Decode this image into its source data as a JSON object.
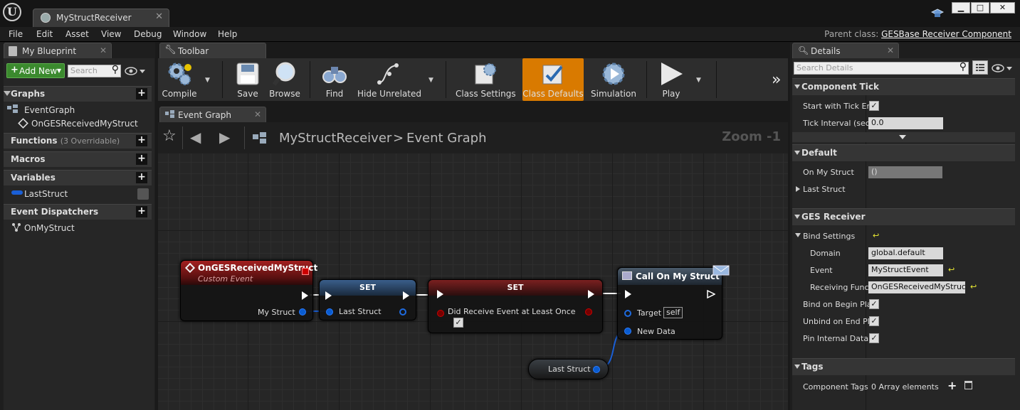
{
  "window": {
    "tab_title": "MyStructReceiver",
    "close": "✕",
    "min": "▁",
    "max": "□",
    "close_btn": "✕"
  },
  "menu": [
    "File",
    "Edit",
    "Asset",
    "View",
    "Debug",
    "Window",
    "Help"
  ],
  "parent_class": {
    "label": "Parent class:",
    "value": "GESBase Receiver Component"
  },
  "my_blueprint": {
    "tab": "My Blueprint",
    "add_new": "Add New",
    "search_placeholder": "Search",
    "graphs": "Graphs",
    "event_graph": "EventGraph",
    "custom_event": "OnGESReceivedMyStruct",
    "functions": "Functions",
    "functions_note": "(3 Overridable)",
    "macros": "Macros",
    "variables": "Variables",
    "var_last": "LastStruct",
    "dispatchers": "Event Dispatchers",
    "dispatcher": "OnMyStruct"
  },
  "toolbar": {
    "tab": "Toolbar",
    "buttons": [
      "Compile",
      "Save",
      "Browse",
      "Find",
      "Hide Unrelated",
      "Class Settings",
      "Class Defaults",
      "Simulation",
      "Play"
    ],
    "overflow": "»"
  },
  "graph": {
    "tab": "Event Graph",
    "breadcrumb_root": "MyStructReceiver",
    "breadcrumb_sep": ">",
    "breadcrumb_leaf": "Event Graph",
    "zoom": "Zoom -1",
    "node_event": {
      "title": "OnGESReceivedMyStruct",
      "subtitle": "Custom Event",
      "pin": "My Struct"
    },
    "node_set1": {
      "title": "SET",
      "pin": "Last Struct"
    },
    "node_set2": {
      "title": "SET",
      "pin": "Did Receive Event at Least Once"
    },
    "node_call": {
      "title": "Call On My Struct",
      "target": "Target",
      "self": "self",
      "new_data": "New Data"
    },
    "node_get": {
      "pin": "Last Struct"
    }
  },
  "details": {
    "tab": "Details",
    "search_placeholder": "Search Details",
    "component_tick": "Component Tick",
    "start_tick": "Start with Tick En",
    "tick_interval": "Tick Interval (sec",
    "tick_value": "0.0",
    "default": "Default",
    "on_my_struct": "On My Struct",
    "on_my_struct_val": "()",
    "last_struct": "Last Struct",
    "ges_receiver": "GES Receiver",
    "bind_settings": "Bind Settings",
    "domain": "Domain",
    "domain_val": "global.default",
    "event": "Event",
    "event_val": "MyStructEvent",
    "receiving": "Receiving Funct",
    "receiving_val": "OnGESReceivedMyStruct",
    "bind_begin": "Bind on Begin Pla",
    "unbind_end": "Unbind on End Pla",
    "pin_internal": "Pin Internal Data t",
    "tags": "Tags",
    "component_tags": "Component Tags",
    "array": "0 Array elements"
  },
  "colors": {
    "accent_orange": "#d97a00",
    "event_red": "#8a1a1a",
    "set_blue": "#2b4a6e",
    "set_red": "#6e1e1e",
    "struct_blue": "#0a5cd0"
  }
}
